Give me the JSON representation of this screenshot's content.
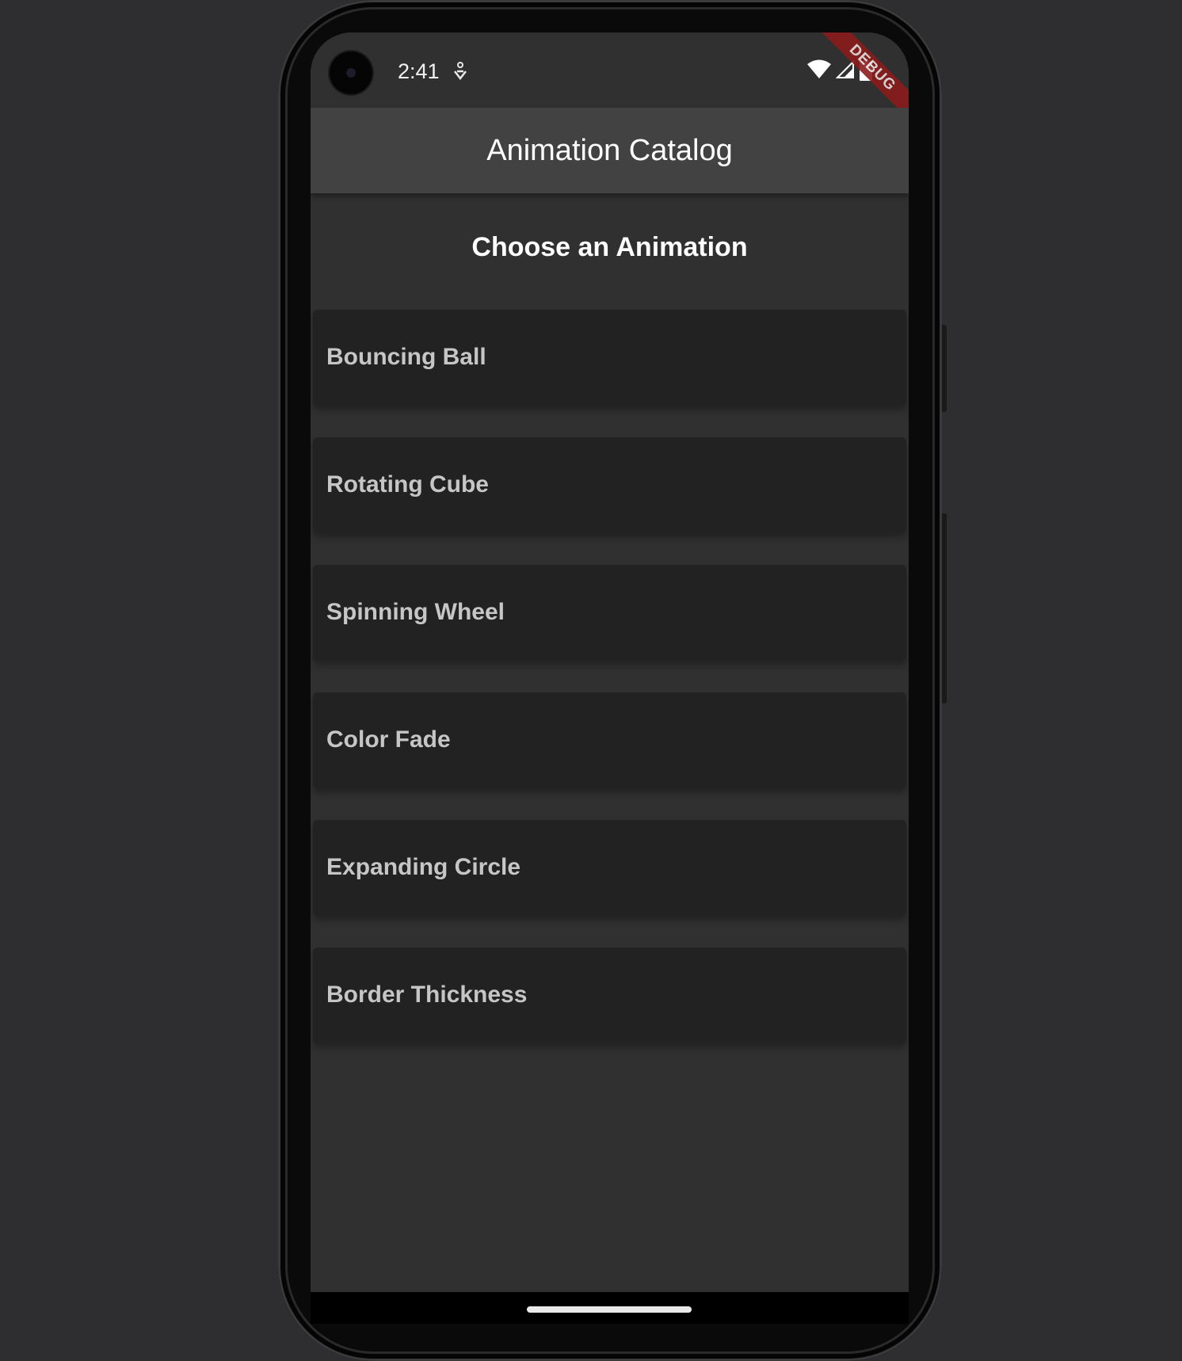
{
  "status_bar": {
    "time": "2:41"
  },
  "debug_banner": "DEBUG",
  "app_bar": {
    "title": "Animation Catalog"
  },
  "main": {
    "heading": "Choose an Animation",
    "items": [
      {
        "label": "Bouncing Ball"
      },
      {
        "label": "Rotating Cube"
      },
      {
        "label": "Spinning Wheel"
      },
      {
        "label": "Color Fade"
      },
      {
        "label": "Expanding Circle"
      },
      {
        "label": "Border Thickness"
      }
    ]
  },
  "colors": {
    "background": "#303030",
    "app_bar": "#424242",
    "card": "#222222",
    "card_text": "#c6c6c6",
    "debug_ribbon": "#8b1c1c"
  },
  "icons": {
    "status": [
      "notification-icon",
      "wifi-icon",
      "signal-icon",
      "battery-icon"
    ]
  }
}
